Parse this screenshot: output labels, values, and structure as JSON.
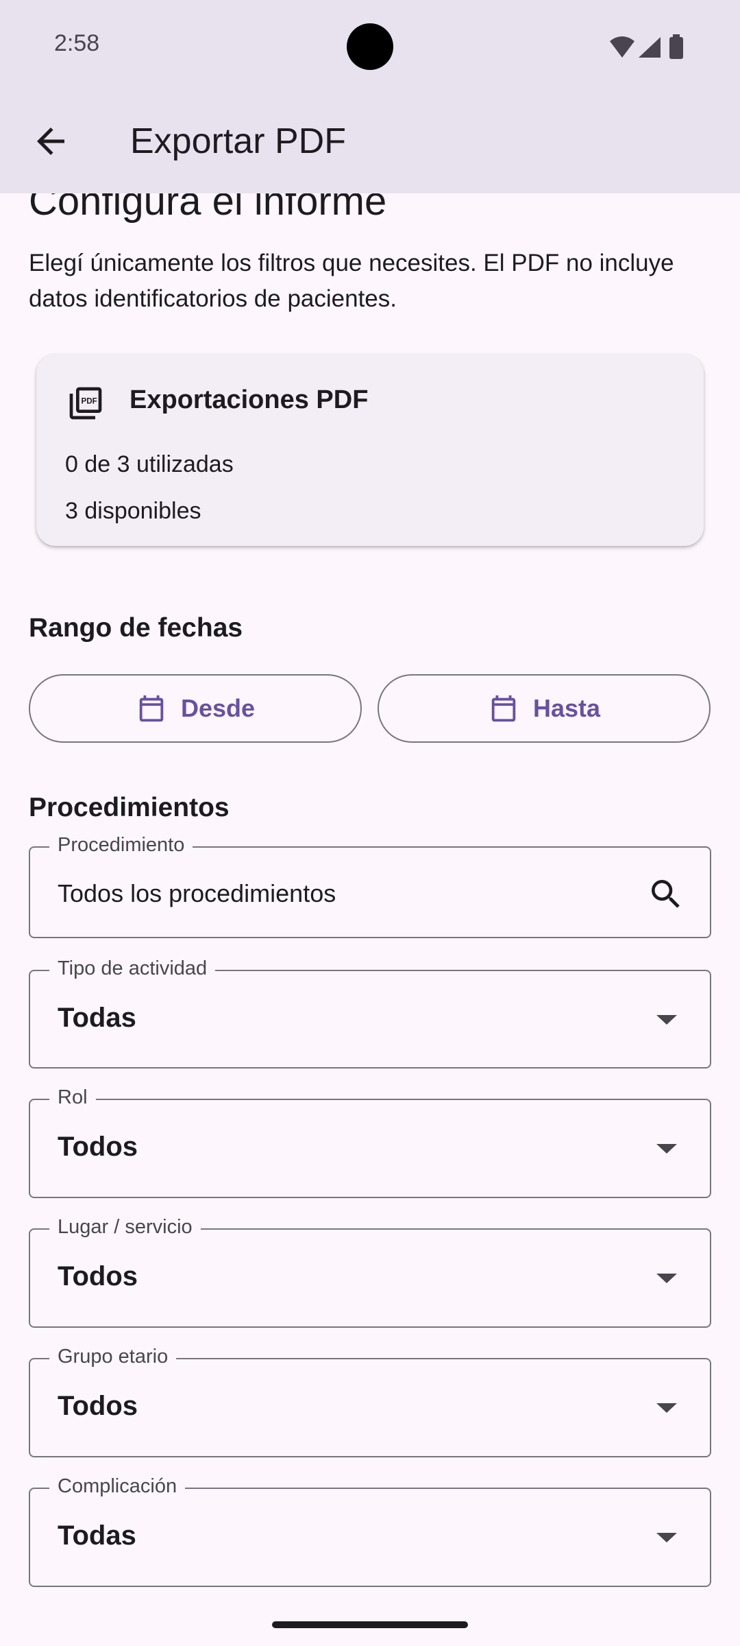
{
  "status_bar": {
    "time": "2:58",
    "icons": [
      "wifi-icon",
      "signal-icon",
      "battery-icon"
    ]
  },
  "app_bar": {
    "title": "Exportar PDF",
    "back_icon": "arrow-back-icon"
  },
  "page": {
    "heading": "Configura el informe",
    "description": "Elegí únicamente los filtros que necesites. El PDF no incluye datos identificatorios de pacientes."
  },
  "export_card": {
    "icon": "pdf-icon",
    "title": "Exportaciones PDF",
    "used": "0 de 3 utilizadas",
    "available": "3 disponibles"
  },
  "date_range": {
    "title": "Rango de fechas",
    "from_label": "Desde",
    "to_label": "Hasta"
  },
  "procedures": {
    "title": "Procedimientos",
    "procedure_field": {
      "label": "Procedimiento",
      "value": "Todos los procedimientos"
    },
    "activity_type": {
      "label": "Tipo de actividad",
      "value": "Todas"
    },
    "role": {
      "label": "Rol",
      "value": "Todos"
    },
    "place": {
      "label": "Lugar / servicio",
      "value": "Todos"
    },
    "age_group": {
      "label": "Grupo etario",
      "value": "Todos"
    },
    "complication": {
      "label": "Complicación",
      "value": "Todas"
    }
  },
  "colors": {
    "accent": "#6750a4",
    "app_bar_bg": "#e8e2ee",
    "page_bg": "#fdf7fd",
    "outline": "#79747e"
  }
}
